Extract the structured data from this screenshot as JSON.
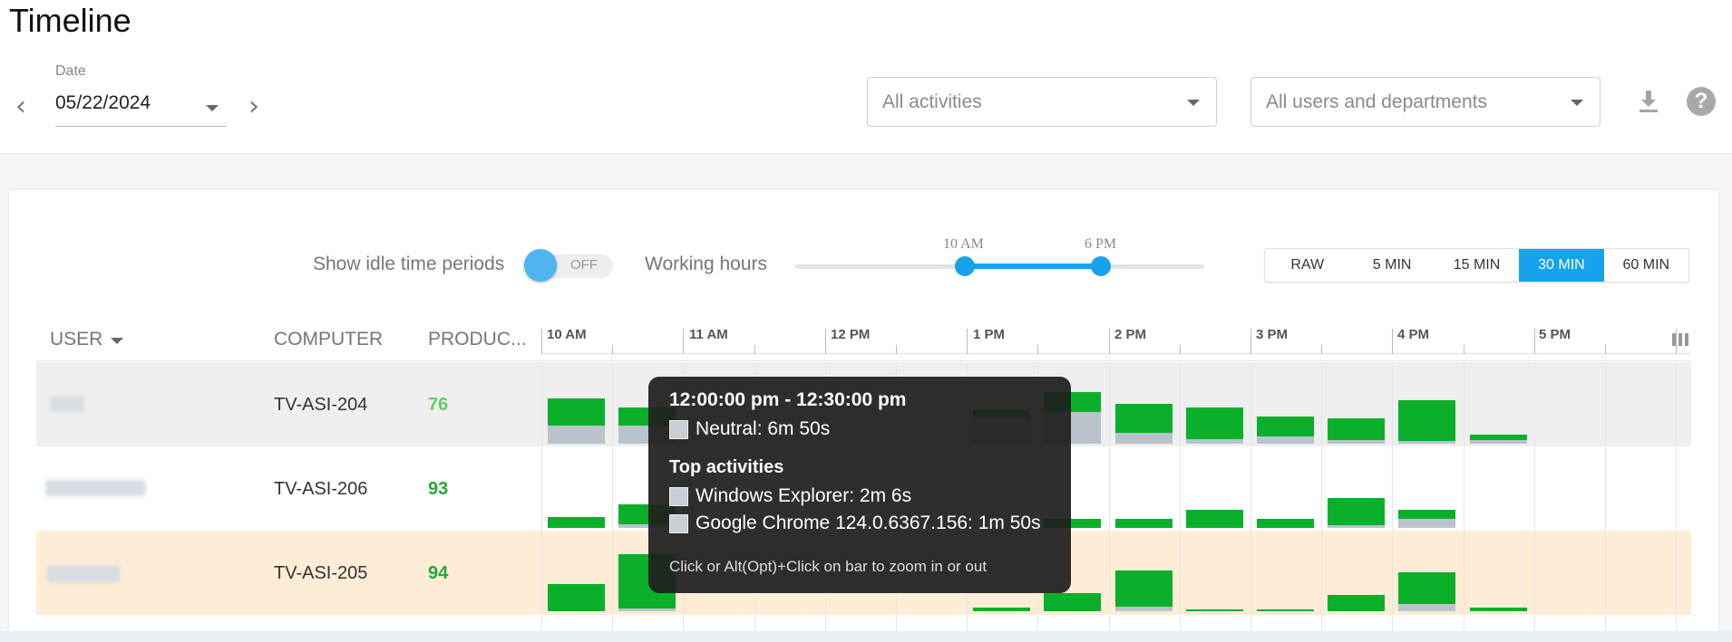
{
  "header": {
    "title": "Timeline",
    "date_label": "Date",
    "date_value": "05/22/2024",
    "activities_placeholder": "All activities",
    "users_placeholder": "All users and departments"
  },
  "controls": {
    "idle_label": "Show idle time periods",
    "idle_toggle": "OFF",
    "working_hours_label": "Working hours",
    "working_start": "10 AM",
    "working_end": "6 PM",
    "intervals": [
      "RAW",
      "5 MIN",
      "15 MIN",
      "30 MIN",
      "60 MIN"
    ],
    "active_interval": "30 MIN"
  },
  "table": {
    "columns": {
      "user": "USER",
      "computer": "COMPUTER",
      "productivity": "PRODUC..."
    },
    "hours": [
      "10 AM",
      "11 AM",
      "12 PM",
      "1 PM",
      "2 PM",
      "3 PM",
      "4 PM",
      "5 PM"
    ],
    "rows": [
      {
        "computer": "TV-ASI-204",
        "productivity": "76",
        "prod_color": "#5fcf6a"
      },
      {
        "computer": "TV-ASI-206",
        "productivity": "93",
        "prod_color": "#24a83a"
      },
      {
        "computer": "TV-ASI-205",
        "productivity": "94",
        "prod_color": "#24a83a"
      }
    ]
  },
  "tooltip": {
    "range": "12:00:00 pm - 12:30:00 pm",
    "neutral": "Neutral: 6m 50s",
    "heading": "Top activities",
    "activity_1": "Windows Explorer: 2m 6s",
    "activity_2": "Google Chrome 124.0.6367.156: 1m 50s",
    "hint": "Click or Alt(Opt)+Click on bar to zoom in or out"
  },
  "colors": {
    "accent": "#17a3ec",
    "productive": "#0bb02a",
    "neutral": "#b9c3cc",
    "highlight_row": "#fdecd6"
  }
}
